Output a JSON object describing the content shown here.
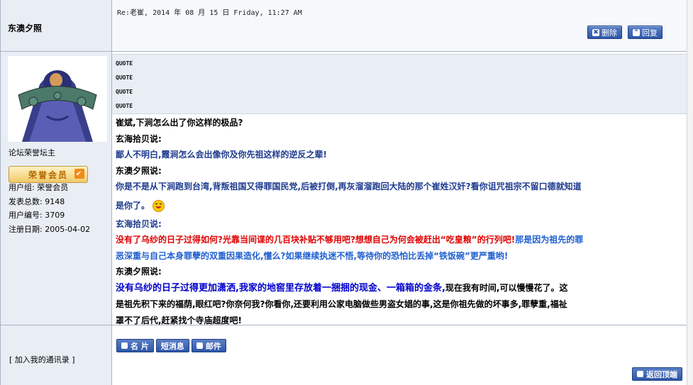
{
  "post": {
    "author": "东澳夕照",
    "meta": "Re:老崔, 2014 年 08 月 15 日 Friday, 11:27 AM",
    "buttons": {
      "delete": "删除",
      "reply": "回复"
    }
  },
  "user": {
    "title": "论坛荣誉坛主",
    "badge": "荣誉会员",
    "group_label": "用户组:",
    "group_value": "荣誉会员",
    "posts_label": "发表总数:",
    "posts_value": "9148",
    "uid_label": "用户编号:",
    "uid_value": "3709",
    "reg_label": "注册日期:",
    "reg_value": "2005-04-02"
  },
  "quotes": [
    "QUOTE",
    "QUOTE",
    "QUOTE",
    "QUOTE"
  ],
  "content": {
    "l1": "崔斌,下涧怎么出了你这样的极品?",
    "l2": "玄海拾贝说:",
    "l3": "鄙人不明白,霞涧怎么会出像你及你先祖这样的逆反之辈!",
    "l4": "东澳夕照说:",
    "l5": "你是不是从下涧跑到台湾,背叛祖国又得罪国民党,后被打倒,再灰溜溜跑回大陆的那个崔姓汉奸?看你诅咒祖宗不留口德就知道",
    "l6": "是你了。",
    "l7": "玄海拾贝说:",
    "l8a": "没有了乌纱的日子过得如何?光靠当间谍的几百块补贴不够用吧?想想自己为何会被赶出“吃皇粮”的行列吧!",
    "l8b": "那是因为祖先的罪",
    "l9a": "恶深重与自己本身罪孽的双重因果造化,懂么?如果继续执迷不悟,等待你的恐怕比丢掉“铁饭碗”更严重哟!",
    "l10": "东澳夕照说:",
    "l11a": "没有乌纱的日子过得更加潇洒,我家的地窖里存放着一捆捆的现金、一箱箱的金条,",
    "l11b": "现在我有时间,可以慢慢花了。这",
    "l12": "是祖先积下来的福荫,眼红吧?你奈何我?你看你,还要利用公家电脑做些男盗女娼的事,这是你祖先做的坏事多,罪孽重,福祉",
    "l13": "罩不了后代,赶紧找个寺庙超度吧!"
  },
  "footer": {
    "add_contact": "[ 加入我的通讯录 ]",
    "card": "名 片",
    "message": "短消息",
    "mail": "邮件",
    "top": "返回顶端"
  }
}
